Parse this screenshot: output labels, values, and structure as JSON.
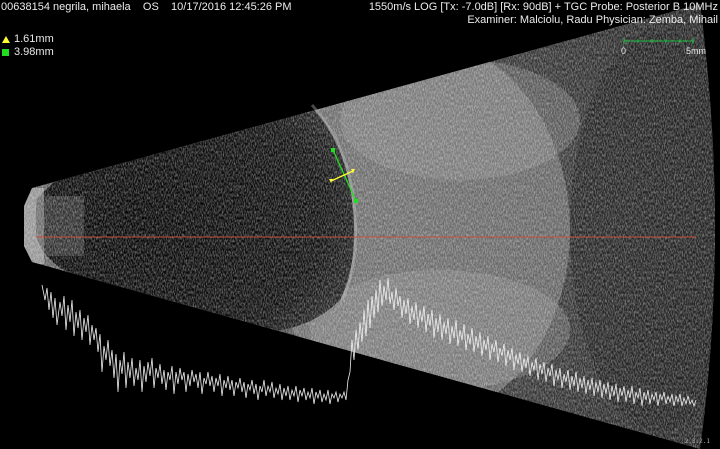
{
  "header": {
    "patient_id": "00638154",
    "patient_name": "negrila, mihaela",
    "eye": "OS",
    "datetime": "10/17/2016 12:45:26 PM",
    "settings": "1550m/s LOG [Tx: -7.0dB] [Rx: 90dB] + TGC Probe: Posterior B 10MHz",
    "examiner_physician": "Examiner: Malciolu, Radu  Physician: Zemba, Mihail"
  },
  "measurements": [
    {
      "marker": "yellow-triangle",
      "color": "#ffff33",
      "value": "1.61mm"
    },
    {
      "marker": "green-square",
      "color": "#22dd22",
      "value": "3.98mm"
    }
  ],
  "scale_bar": {
    "start": "0",
    "end": "5mm"
  },
  "corner_tag": "2.3.2.1",
  "colors": {
    "background": "#000000",
    "center_line": "#c8503a",
    "a_scan_trace": "#f0f0f0",
    "caliper_yellow": "#ffff33",
    "caliper_green": "#22dd22"
  }
}
